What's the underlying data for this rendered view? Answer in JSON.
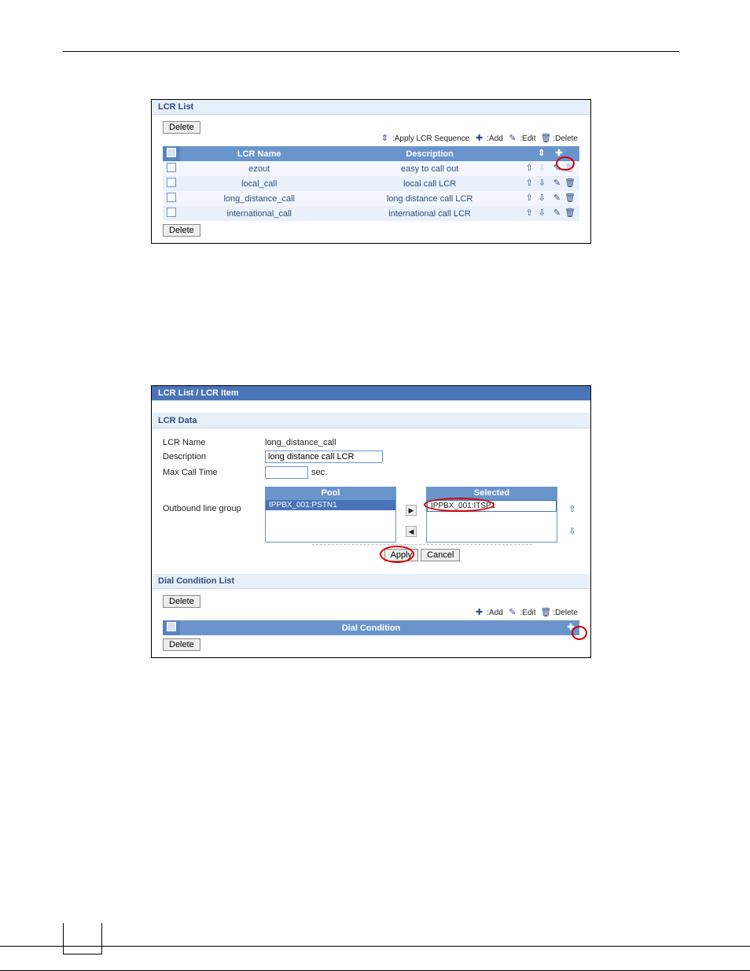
{
  "panel1": {
    "title": "LCR List",
    "delete": "Delete",
    "legend": {
      "seq": ":Apply LCR Sequence",
      "add": ":Add",
      "edit": ":Edit",
      "del": ":Delete"
    },
    "headers": {
      "name": "LCR Name",
      "desc": "Description"
    },
    "rows": [
      {
        "name": "ezout",
        "desc": "easy to call out",
        "first": true
      },
      {
        "name": "local_call",
        "desc": "local call LCR"
      },
      {
        "name": "long_distance_call",
        "desc": "long distance call LCR"
      },
      {
        "name": "international_call",
        "desc": "international call LCR"
      }
    ]
  },
  "panel2": {
    "breadcrumb": "LCR List / LCR Item",
    "dataTitle": "LCR Data",
    "labels": {
      "name": "LCR Name",
      "desc": "Description",
      "max": "Max Call Time",
      "group": "Outbound line group",
      "sec": "sec."
    },
    "vals": {
      "name": "long_distance_call",
      "desc": "long distance call LCR",
      "max": ""
    },
    "poolHdr": "Pool",
    "selHdr": "Selected",
    "pool": [
      "IPPBX_001:PSTN1"
    ],
    "selected": [
      "IPPBX_001:ITSP1"
    ],
    "apply": "Apply",
    "cancel": "Cancel",
    "dialTitle": "Dial Condition List",
    "dialHdr": "Dial Condition",
    "delete": "Delete",
    "legend": {
      "add": ":Add",
      "edit": ":Edit",
      "del": ":Delete"
    }
  }
}
